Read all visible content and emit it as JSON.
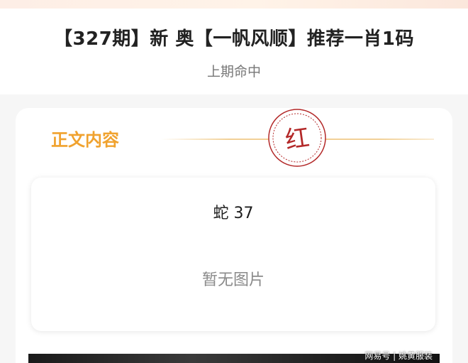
{
  "header": {
    "headline": "【327期】新 奥【一帆风顺】推荐一肖1码",
    "subtitle": "上期命中"
  },
  "content": {
    "section_title": "正文内容",
    "seal_character": "红",
    "prediction": "蛇 37",
    "no_image_text": "暂无图片"
  },
  "watermark": {
    "text": "网易号 | 姚黄服装"
  },
  "colors": {
    "accent_orange": "#f0a22e",
    "seal_red": "#b32828",
    "divider_gold": "#f2d096"
  }
}
